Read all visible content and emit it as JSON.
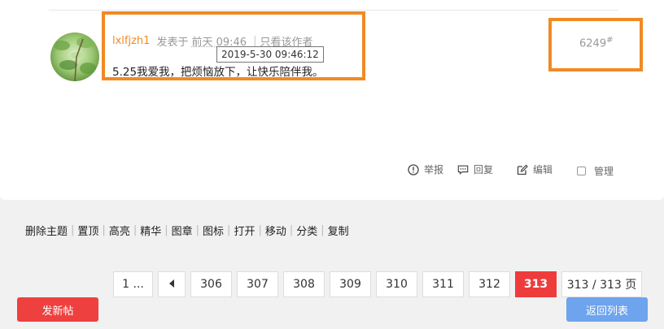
{
  "post": {
    "author": "lxlfjzh1",
    "posted_prefix": "发表于",
    "posted_relative": "前天 09:46",
    "separator": "|",
    "only_author": "只看该作者",
    "tooltip_datetime": "2019-5-30 09:46:12",
    "content": "5.25我爱我，把烦恼放下，让快乐陪伴我。",
    "floor_number": "6249",
    "floor_suffix": "#"
  },
  "actions": {
    "report": "举报",
    "reply": "回复",
    "edit": "编辑",
    "manage": "管理"
  },
  "moderation": [
    "删除主题",
    "置顶",
    "高亮",
    "精华",
    "图章",
    "图标",
    "打开",
    "移动",
    "分类",
    "复制"
  ],
  "pagination": {
    "first": "1 ...",
    "prev_icon": "triangle-left-icon",
    "pages": [
      "306",
      "307",
      "308",
      "309",
      "310",
      "311",
      "312"
    ],
    "current": "313",
    "total": "313 / 313 页"
  },
  "buttons": {
    "new_post": "发新帖",
    "back_to_list": "返回列表"
  },
  "colors": {
    "author": "#f08a24",
    "highlight_border": "#f08a24",
    "active_page": "#ee3c3c",
    "new_post_button": "#ef4040",
    "back_button": "#6ea3ee"
  }
}
